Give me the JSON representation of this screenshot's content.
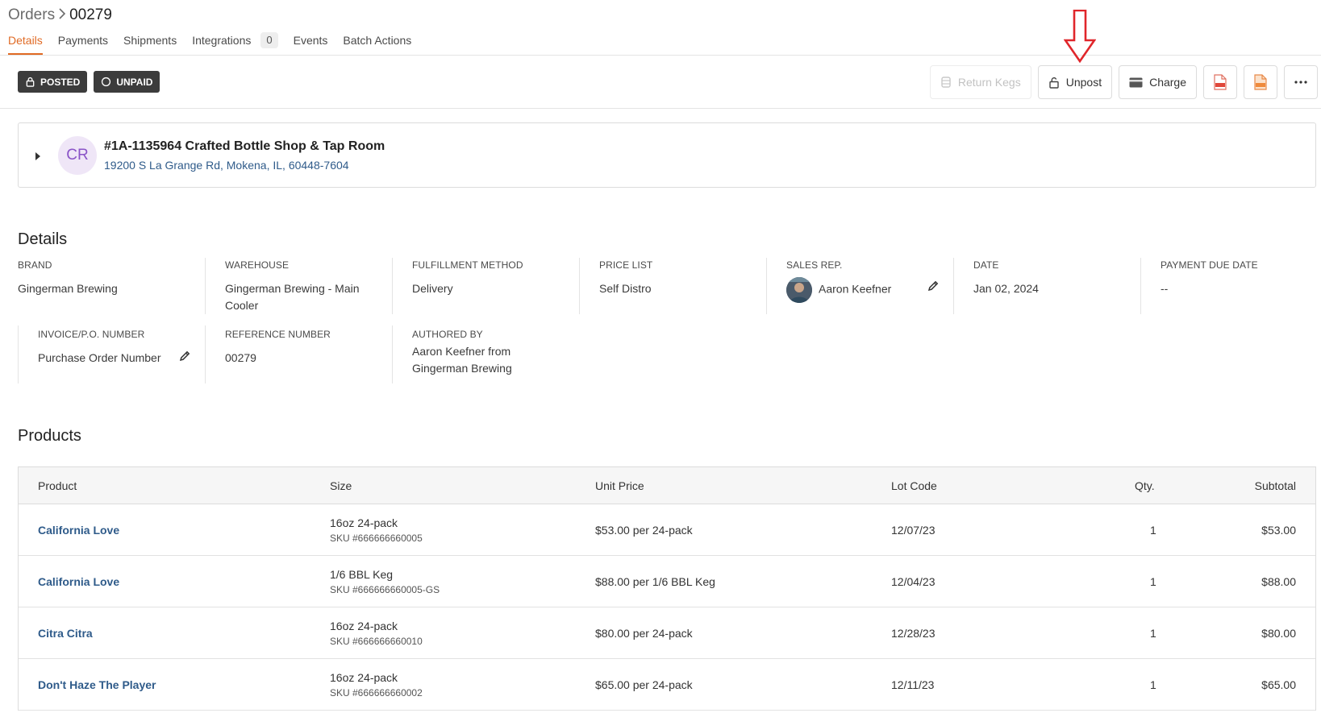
{
  "breadcrumb": {
    "root": "Orders",
    "current": "00279"
  },
  "tabs": [
    {
      "label": "Details"
    },
    {
      "label": "Payments"
    },
    {
      "label": "Shipments"
    },
    {
      "label": "Integrations",
      "count": "0"
    },
    {
      "label": "Events"
    },
    {
      "label": "Batch Actions"
    }
  ],
  "status": {
    "posted": "POSTED",
    "unpaid": "UNPAID"
  },
  "actions": {
    "return_kegs": "Return Kegs",
    "unpost": "Unpost",
    "charge": "Charge"
  },
  "customer": {
    "initials": "CR",
    "name": "#1A-1135964 Crafted Bottle Shop & Tap Room",
    "address": "19200 S La Grange Rd, Mokena, IL, 60448-7604"
  },
  "details": {
    "title": "Details",
    "brand": {
      "label": "BRAND",
      "value": "Gingerman Brewing"
    },
    "warehouse": {
      "label": "WAREHOUSE",
      "value_line1": "Gingerman Brewing - Main",
      "value_line2": "Cooler"
    },
    "fulfillment": {
      "label": "FULFILLMENT METHOD",
      "value": "Delivery"
    },
    "price_list": {
      "label": "PRICE LIST",
      "value": "Self Distro"
    },
    "sales_rep": {
      "label": "SALES REP.",
      "value": "Aaron Keefner"
    },
    "date": {
      "label": "DATE",
      "value": "Jan 02, 2024"
    },
    "payment_due": {
      "label": "PAYMENT DUE DATE",
      "value": "--"
    },
    "invoice": {
      "label": "INVOICE/P.O. NUMBER",
      "placeholder": "Purchase Order Number"
    },
    "reference": {
      "label": "REFERENCE NUMBER",
      "value": "00279"
    },
    "authored": {
      "label": "AUTHORED BY",
      "value_line1": "Aaron Keefner from",
      "value_line2": "Gingerman Brewing"
    }
  },
  "products": {
    "title": "Products",
    "columns": {
      "product": "Product",
      "size": "Size",
      "unit_price": "Unit Price",
      "lot_code": "Lot Code",
      "qty": "Qty.",
      "subtotal": "Subtotal"
    },
    "rows": [
      {
        "product": "California Love",
        "size": "16oz 24-pack",
        "sku": "SKU #666666660005",
        "unit_price": "$53.00 per 24-pack",
        "lot_code": "12/07/23",
        "qty": "1",
        "subtotal": "$53.00"
      },
      {
        "product": "California Love",
        "size": "1/6 BBL Keg",
        "sku": "SKU #666666660005-GS",
        "unit_price": "$88.00 per 1/6 BBL Keg",
        "lot_code": "12/04/23",
        "qty": "1",
        "subtotal": "$88.00"
      },
      {
        "product": "Citra Citra",
        "size": "16oz 24-pack",
        "sku": "SKU #666666660010",
        "unit_price": "$80.00 per 24-pack",
        "lot_code": "12/28/23",
        "qty": "1",
        "subtotal": "$80.00"
      },
      {
        "product": "Don't Haze The Player",
        "size": "16oz 24-pack",
        "sku": "SKU #666666660002",
        "unit_price": "$65.00 per 24-pack",
        "lot_code": "12/11/23",
        "qty": "1",
        "subtotal": "$65.00"
      }
    ]
  },
  "colors": {
    "accent": "#e06a24",
    "link": "#2f5b8a",
    "badge": "#3c3c3c",
    "annotation": "#e0262b"
  }
}
